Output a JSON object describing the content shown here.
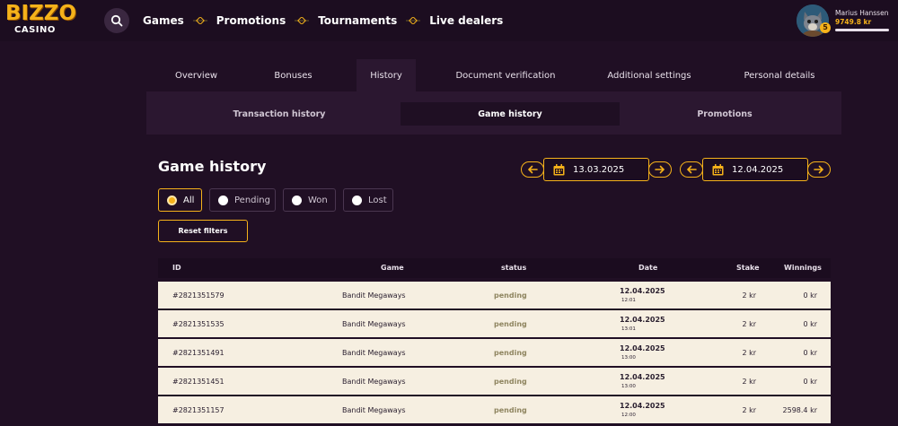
{
  "header": {
    "logo_main": "BIZZO",
    "logo_sub": "CASINO",
    "nav": [
      {
        "label": "Games"
      },
      {
        "label": "Promotions"
      },
      {
        "label": "Tournaments"
      },
      {
        "label": "Live dealers"
      }
    ],
    "user": {
      "name": "Marius Hanssen",
      "balance": "9749.8 kr",
      "level": "5"
    }
  },
  "account_tabs": [
    {
      "label": "Overview"
    },
    {
      "label": "Bonuses"
    },
    {
      "label": "History"
    },
    {
      "label": "Document verification"
    },
    {
      "label": "Additional settings"
    },
    {
      "label": "Personal details"
    }
  ],
  "active_tab": "History",
  "sub_tabs": [
    {
      "label": "Transaction history"
    },
    {
      "label": "Game history"
    },
    {
      "label": "Promotions"
    }
  ],
  "active_sub_tab": "Game history",
  "page_title": "Game history",
  "date_range": {
    "from": "13.03.2025",
    "to": "12.04.2025"
  },
  "filters": [
    {
      "label": "All",
      "selected": true
    },
    {
      "label": "Pending",
      "selected": false
    },
    {
      "label": "Won",
      "selected": false
    },
    {
      "label": "Lost",
      "selected": false
    }
  ],
  "reset_label": "Reset filters",
  "table": {
    "columns": [
      "ID",
      "Game",
      "status",
      "Date",
      "Stake",
      "Winnings"
    ],
    "rows": [
      {
        "id": "#2821351579",
        "game": "Bandit Megaways",
        "status": "pending",
        "date": "12.04.2025",
        "time": "12:01",
        "stake": "2 kr",
        "winnings": "0 kr"
      },
      {
        "id": "#2821351535",
        "game": "Bandit Megaways",
        "status": "pending",
        "date": "12.04.2025",
        "time": "13:01",
        "stake": "2 kr",
        "winnings": "0 kr"
      },
      {
        "id": "#2821351491",
        "game": "Bandit Megaways",
        "status": "pending",
        "date": "12.04.2025",
        "time": "13:00",
        "stake": "2 kr",
        "winnings": "0 kr"
      },
      {
        "id": "#2821351451",
        "game": "Bandit Megaways",
        "status": "pending",
        "date": "12.04.2025",
        "time": "13:00",
        "stake": "2 kr",
        "winnings": "0 kr"
      },
      {
        "id": "#2821351157",
        "game": "Bandit Megaways",
        "status": "pending",
        "date": "12.04.2025",
        "time": "12:00",
        "stake": "2 kr",
        "winnings": "2598.4 kr"
      }
    ]
  },
  "colors": {
    "background": "#200f24",
    "accent": "#f5b21a",
    "row_background": "#f6efe1",
    "pending_status": "#8f8560"
  }
}
